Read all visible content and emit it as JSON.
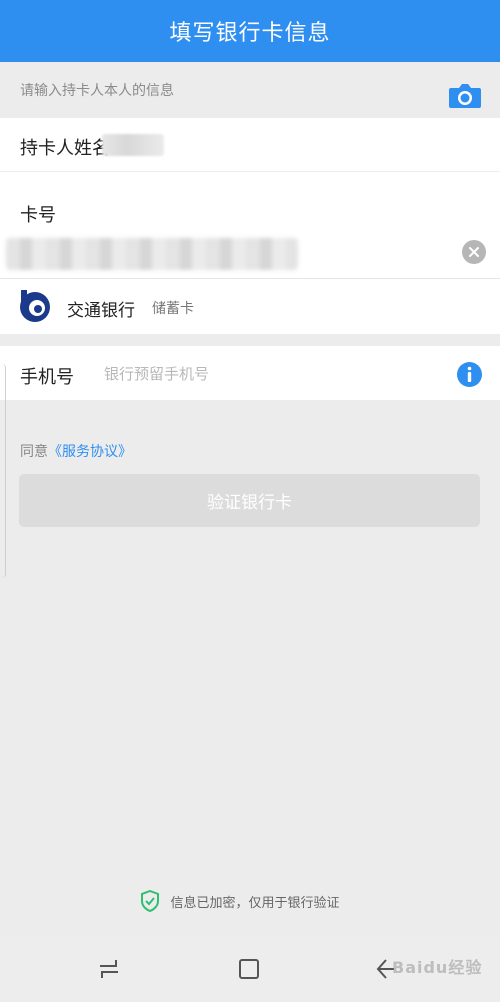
{
  "header": {
    "title": "填写银行卡信息"
  },
  "hint": "请输入持卡人本人的信息",
  "form": {
    "name_label": "持卡人姓名",
    "card_label": "卡号",
    "bank": {
      "name": "交通银行",
      "type": "储蓄卡"
    },
    "phone_label": "手机号",
    "phone_placeholder": "银行预留手机号"
  },
  "agreement": {
    "prefix": "同意",
    "link": "《服务协议》"
  },
  "verify_button": "验证银行卡",
  "security_note": "信息已加密，仅用于银行验证",
  "watermark": "Baidu经验",
  "colors": {
    "accent": "#2f8ff0",
    "bank_logo": "#1b3a8c",
    "shield": "#2fbf71"
  },
  "icons": [
    "camera-icon",
    "clear-icon",
    "bank-logo-icon",
    "info-icon",
    "shield-icon",
    "nav-recent-icon",
    "nav-home-icon",
    "nav-back-icon"
  ]
}
